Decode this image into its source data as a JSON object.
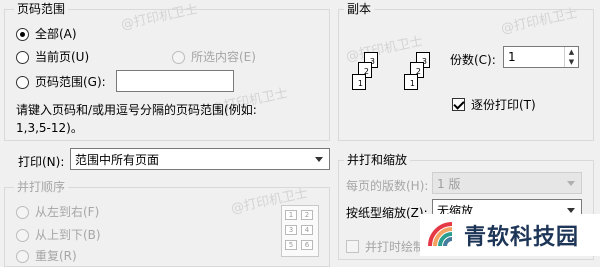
{
  "page_range": {
    "title": "页码范围",
    "all": "全部(A)",
    "current_page": "当前页(U)",
    "selection": "所选内容(E)",
    "page_numbers": "页码范围(G):",
    "page_numbers_value": "",
    "hint_line1": "请键入页码和/或用逗号分隔的页码范围(例如:",
    "hint_line2": "1,3,5-12)。"
  },
  "copies": {
    "title": "副本",
    "count_label": "份数(C):",
    "count_value": "1",
    "collate_label": "逐份打印(T)",
    "collate_checked": true,
    "stack1": [
      "1",
      "2",
      "3"
    ],
    "stack2": [
      "1",
      "2",
      "3"
    ]
  },
  "print_what": {
    "label": "打印(N):",
    "value": "范围中所有页面"
  },
  "print_order": {
    "title": "并打顺序",
    "left_to_right": "从左到右(F)",
    "top_to_bottom": "从上到下(B)",
    "repeat": "重复(R)",
    "preview_cells": [
      "1",
      "2",
      "3",
      "4",
      "5",
      "6"
    ]
  },
  "zoom": {
    "title": "并打和缩放",
    "pages_per_sheet_label": "每页的版数(H):",
    "pages_per_sheet_value": "1 版",
    "scale_to_paper_label": "按纸型缩放(Z):",
    "scale_to_paper_value": "无缩放",
    "draw_borders_label": "并打时绘制分隔线(D)"
  },
  "watermark": {
    "text": "@打印机卫士",
    "brand": "青软科技园"
  }
}
